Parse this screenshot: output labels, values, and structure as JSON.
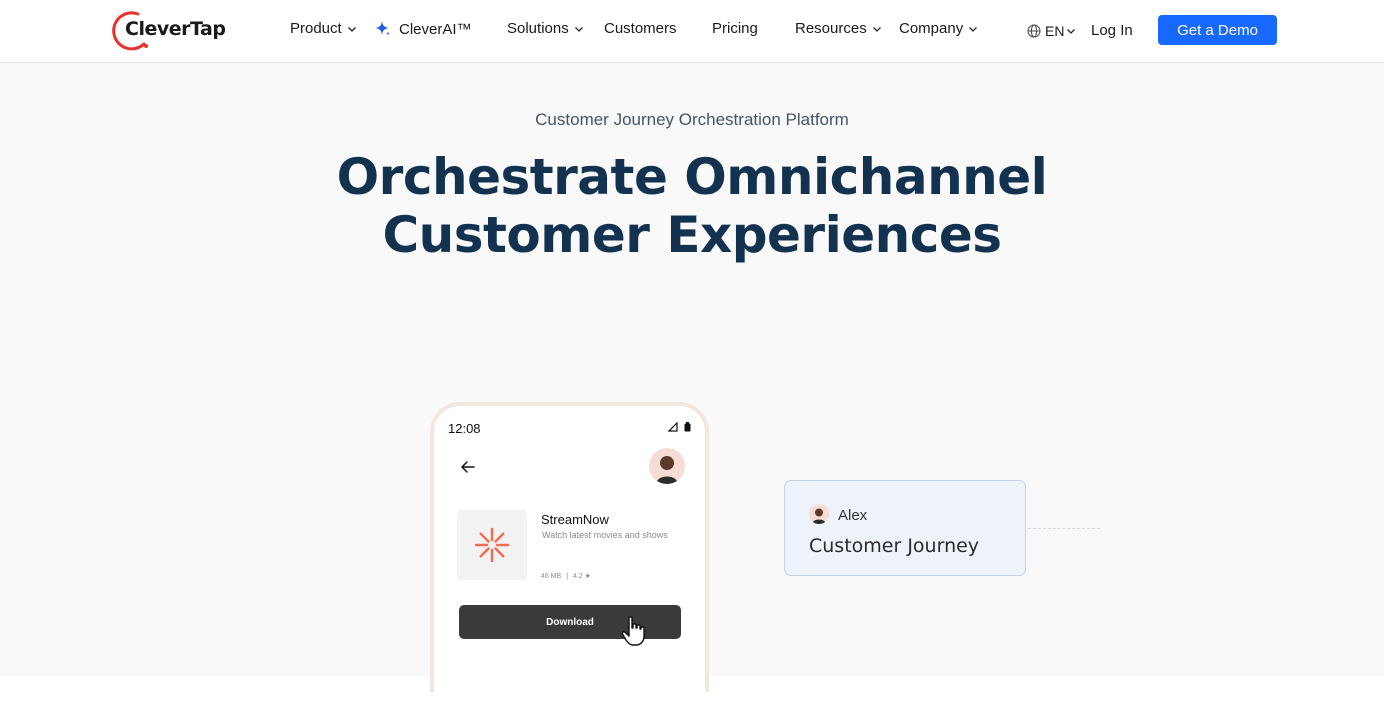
{
  "brand": {
    "name": "CleverTap",
    "accent": "#1769ff",
    "logo_arc": "#e8322c"
  },
  "nav": {
    "items": [
      {
        "label": "Product",
        "has_menu": true
      },
      {
        "label": "CleverAI™",
        "has_menu": false
      },
      {
        "label": "Solutions",
        "has_menu": true
      },
      {
        "label": "Customers",
        "has_menu": false
      },
      {
        "label": "Pricing",
        "has_menu": false
      },
      {
        "label": "Resources",
        "has_menu": true
      },
      {
        "label": "Company",
        "has_menu": true
      }
    ],
    "language": "EN",
    "login": "Log In",
    "cta": "Get a Demo"
  },
  "hero": {
    "eyebrow": "Customer Journey Orchestration Platform",
    "headline_line1": "Orchestrate Omnichannel",
    "headline_line2": "Customer Experiences"
  },
  "phone": {
    "time": "12:08",
    "app": {
      "name": "StreamNow",
      "description": "Watch latest movies and shows",
      "size": "46 MB",
      "rating": "4.2 ★"
    },
    "download_label": "Download"
  },
  "journey_card": {
    "user": "Alex",
    "title": "Customer Journey"
  },
  "colors": {
    "headline": "#12324f",
    "hero_bg": "#f9f9f9",
    "card_bg": "#eef3fb",
    "button_dark": "#3a3a3a"
  }
}
